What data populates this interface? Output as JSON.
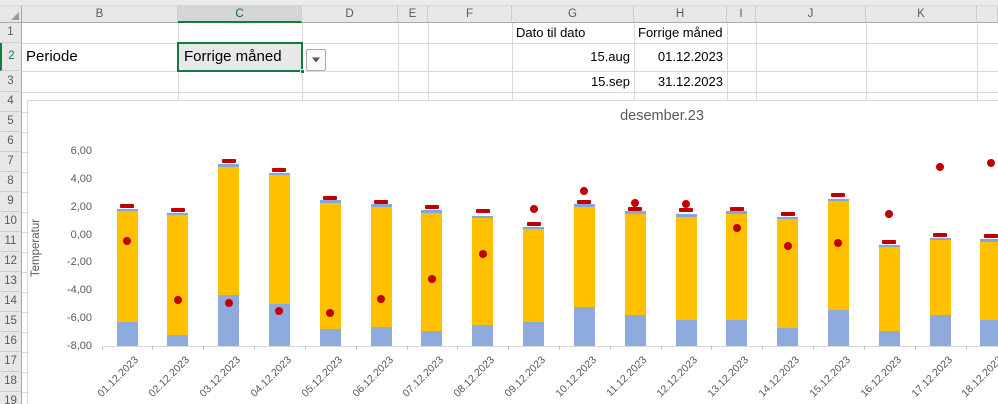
{
  "sheet": {
    "columns": [
      "B",
      "C",
      "D",
      "E",
      "F",
      "G",
      "H",
      "I",
      "J",
      "K"
    ],
    "rows": [
      "1",
      "2",
      "3",
      "4",
      "5",
      "6",
      "7",
      "8",
      "9",
      "10",
      "11",
      "12",
      "13",
      "14",
      "15",
      "16",
      "17",
      "18",
      "19"
    ],
    "cells": [
      {
        "col": "B",
        "row": 2,
        "text": "Periode",
        "align": "left",
        "size": "lg"
      },
      {
        "col": "G",
        "row": 1,
        "text": "Dato til dato",
        "align": "left",
        "size": "sm"
      },
      {
        "col": "H",
        "row": 1,
        "text": "Forrige måned",
        "align": "left",
        "size": "sm"
      },
      {
        "col": "G",
        "row": 2,
        "text": "15.aug",
        "align": "right",
        "size": "sm"
      },
      {
        "col": "H",
        "row": 2,
        "text": "01.12.2023",
        "align": "right",
        "size": "sm"
      },
      {
        "col": "G",
        "row": 3,
        "text": "15.sep",
        "align": "right",
        "size": "sm"
      },
      {
        "col": "H",
        "row": 3,
        "text": "31.12.2023",
        "align": "right",
        "size": "sm"
      }
    ],
    "selection": {
      "col": "C",
      "row": "2",
      "value": "Forrige måned",
      "has_dropdown": true
    },
    "accent_green": "#107C41"
  },
  "chart_data": {
    "type": "bar",
    "subtype": "stacked-bars-with-scatter-markers",
    "title": "desember.23",
    "ylabel": "Temperatur",
    "xlabel": "",
    "ylim": [
      -8,
      6
    ],
    "grid": false,
    "legend": "none",
    "baseline": -8,
    "y_ticks": [
      {
        "label": "6,00",
        "value": 6
      },
      {
        "label": "4,00",
        "value": 4
      },
      {
        "label": "2,00",
        "value": 2
      },
      {
        "label": "0,00",
        "value": 0
      },
      {
        "label": "-2,00",
        "value": -2
      },
      {
        "label": "-4,00",
        "value": -4
      },
      {
        "label": "-6,00",
        "value": -6
      },
      {
        "label": "-8,00",
        "value": -8
      }
    ],
    "categories": [
      "01.12.2023",
      "02.12.2023",
      "03.12.2023",
      "04.12.2023",
      "05.12.2023",
      "06.12.2023",
      "07.12.2023",
      "08.12.2023",
      "09.12.2023",
      "10.12.2023",
      "11.12.2023",
      "12.12.2023",
      "13.12.2023",
      "14.12.2023",
      "15.12.2023",
      "16.12.2023",
      "17.12.2023",
      "18.12.2023"
    ],
    "series": [
      {
        "name": "blue_base_segment_top",
        "color": "#8FAADC",
        "note": "stacked from baseline -8 up to this value",
        "values": [
          -6.3,
          -7.2,
          -4.3,
          -5.0,
          -6.8,
          -6.6,
          -6.9,
          -6.5,
          -6.3,
          -5.2,
          -5.8,
          -6.1,
          -6.1,
          -6.7,
          -5.4,
          -6.9,
          -5.8,
          -6.1
        ]
      },
      {
        "name": "orange_segment_top",
        "color": "#FFC000",
        "note": "orange stack from blue segment top up to this value; thin blue cap at very top",
        "values": [
          1.9,
          1.6,
          5.1,
          4.5,
          2.5,
          2.2,
          1.8,
          1.4,
          0.6,
          2.2,
          1.7,
          1.5,
          1.7,
          1.3,
          2.6,
          -0.7,
          -0.2,
          -0.3
        ]
      },
      {
        "name": "red_dash_marker",
        "color": "#C00000",
        "note": "short horizontal dash at bar top",
        "values": [
          2.1,
          1.8,
          5.3,
          4.7,
          2.7,
          2.4,
          2.0,
          1.7,
          0.8,
          2.4,
          1.9,
          1.8,
          1.9,
          1.5,
          2.9,
          -0.5,
          0.0,
          -0.1
        ]
      },
      {
        "name": "red_dot_marker",
        "color": "#C00000",
        "note": "round scatter point",
        "values": [
          -0.4,
          -4.7,
          -4.9,
          -5.5,
          -5.6,
          -4.6,
          -3.2,
          -1.4,
          1.9,
          3.2,
          2.3,
          2.2,
          0.5,
          -0.8,
          -0.6,
          1.5,
          4.9,
          5.2
        ]
      }
    ],
    "cap_color": "#82A7DE"
  }
}
